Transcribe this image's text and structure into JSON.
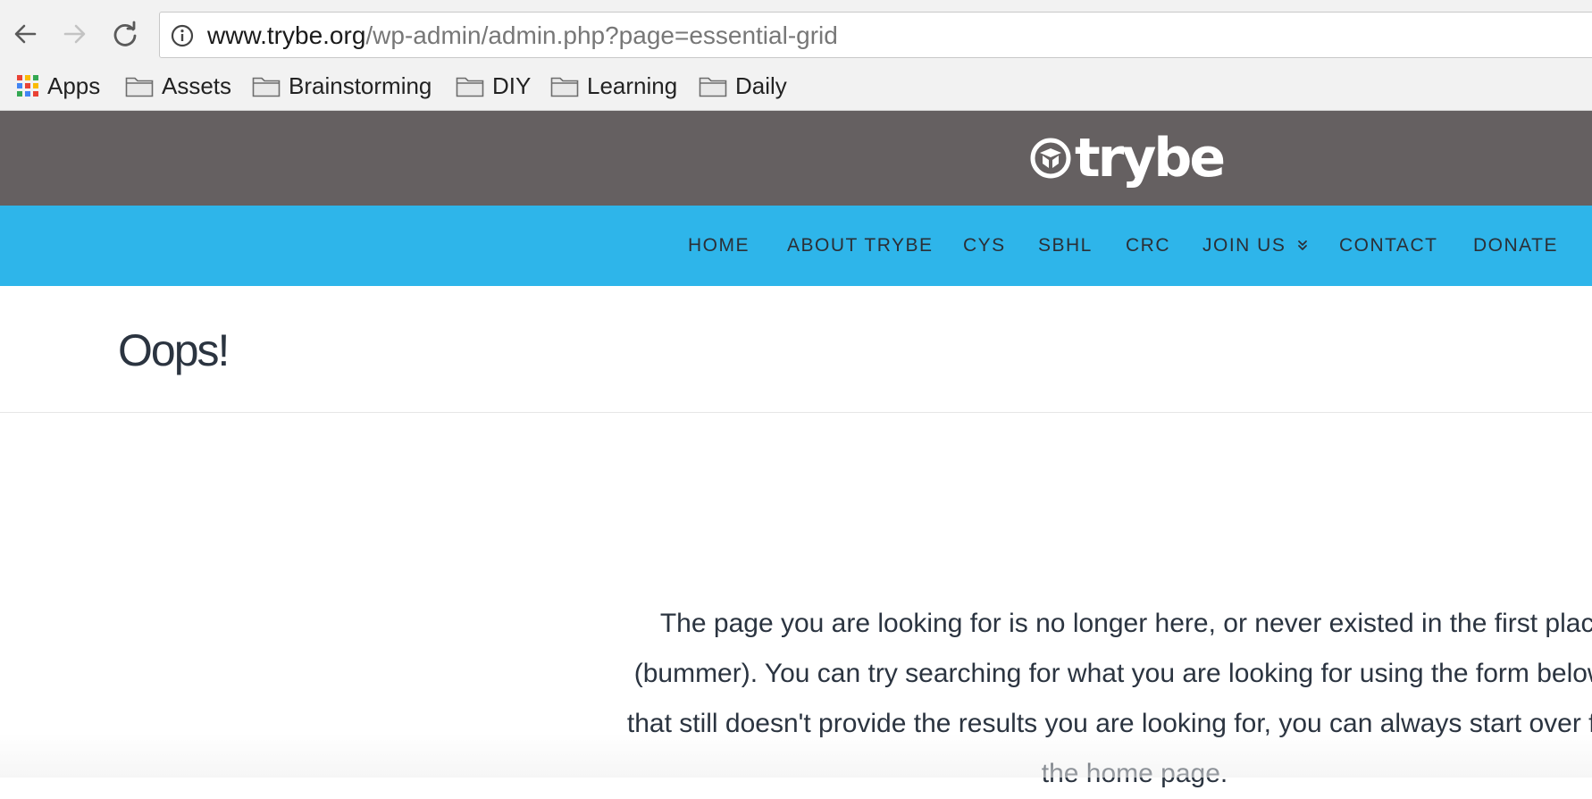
{
  "browser": {
    "url_host": "www.trybe.org",
    "url_path": "/wp-admin/admin.php?page=essential-grid",
    "back_icon": "arrow-left-icon",
    "forward_icon": "arrow-right-icon",
    "reload_icon": "reload-icon",
    "info_icon": "info-icon"
  },
  "bookmarks": [
    {
      "label": "Apps",
      "icon": "apps-grid-icon"
    },
    {
      "label": "Assets",
      "icon": "folder-icon"
    },
    {
      "label": "Brainstorming",
      "icon": "folder-icon"
    },
    {
      "label": "DIY",
      "icon": "folder-icon"
    },
    {
      "label": "Learning",
      "icon": "folder-icon"
    },
    {
      "label": "Daily",
      "icon": "folder-icon"
    }
  ],
  "site": {
    "logo_text": "trybe",
    "header_color": "#656061",
    "nav_color": "#2eb5ea",
    "nav": [
      {
        "label": "HOME"
      },
      {
        "label": "ABOUT TRYBE"
      },
      {
        "label": "CYS"
      },
      {
        "label": "SBHL"
      },
      {
        "label": "CRC"
      },
      {
        "label": "JOIN US",
        "has_dropdown": true
      },
      {
        "label": "CONTACT"
      },
      {
        "label": "DONATE"
      }
    ]
  },
  "content": {
    "title": "Oops!",
    "message": "The page you are looking for is no longer here, or never existed in the first place (bummer). You can try searching for what you are looking for using the form below. If that still doesn't provide the results you are looking for, you can always start over from the home page."
  }
}
